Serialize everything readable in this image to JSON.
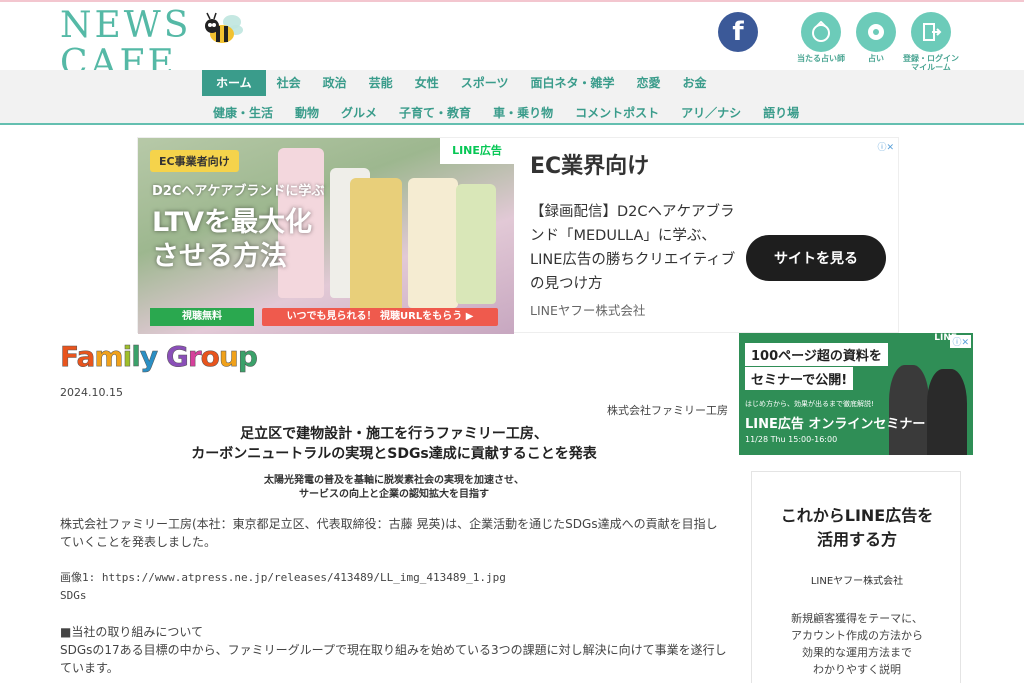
{
  "header": {
    "logo_line1": "NEWS",
    "logo_line2": "CAFE",
    "facebook_label": "f",
    "icons": [
      {
        "name": "fortune-telling",
        "label": "当たる占い師"
      },
      {
        "name": "horoscope",
        "label": "占い"
      },
      {
        "name": "register-login",
        "label": "登録・ログイン\nマイルーム"
      }
    ]
  },
  "nav": {
    "row1": [
      "ホーム",
      "社会",
      "政治",
      "芸能",
      "女性",
      "スポーツ",
      "面白ネタ・雑学",
      "恋愛",
      "お金"
    ],
    "row2": [
      "健康・生活",
      "動物",
      "グルメ",
      "子育て・教育",
      "車・乗り物",
      "コメントポスト",
      "アリ／ナシ",
      "語り場"
    ],
    "active": "ホーム"
  },
  "ad_top": {
    "badge": "EC事業者向け",
    "sub": "D2Cヘアケアブランドに学ぶ",
    "big1": "LTVを最大化",
    "big2": "させる方法",
    "green_btn": "視聴無料",
    "red_btn": "いつでも見られる！ 視聴URLをもらう ▶",
    "line_flag": "LINE広告",
    "headline": "EC業界向け",
    "body": "【録画配信】D2Cヘアケアブランド「MEDULLA」に学ぶ、LINE広告の勝ちクリエイティブの見つけ方",
    "company": "LINEヤフー株式会社",
    "cta": "サイトを見る",
    "adchoices": "ⓘ✕"
  },
  "ad_side": {
    "line1": "100ページ超の資料を",
    "line2": "セミナーで公開!",
    "small": "はじめ方から、効果が出るまで徹底解説!",
    "title": "LINE広告 オンラインセミナー",
    "date": "11/28 Thu 15:00-16:00",
    "flag": "LINE",
    "adchoices": "ⓘ✕"
  },
  "side_box": {
    "title": "これからLINE広告を活用する方",
    "company": "LINEヤフー株式会社",
    "desc": "新規顧客獲得をテーマに、アカウント作成の方法から効果的な運用方法までわかりやすく説明"
  },
  "article": {
    "logo_text": "Family Group",
    "date": "2024.10.15",
    "company": "株式会社ファミリー工房",
    "title_line1": "足立区で建物設計・施工を行うファミリー工房、",
    "title_line2": "カーボンニュートラルの実現とSDGs達成に貢献することを発表",
    "sub_line1": "太陽光発電の普及を基軸に脱炭素社会の実現を加速させ、",
    "sub_line2": "サービスの向上と企業の認知拡大を目指す",
    "para1": "株式会社ファミリー工房(本社：東京都足立区、代表取締役：古藤 晃英)は、企業活動を通じたSDGs達成への貢献を目指していくことを発表しました。",
    "image_ref": "画像1: https://www.atpress.ne.jp/releases/413489/LL_img_413489_1.jpg",
    "image_caption": "SDGs",
    "section_heading": "■当社の取り組みについて",
    "para2": "SDGsの17ある目標の中から、ファミリーグループで現在取り組みを始めている3つの課題に対し解決に向けて事業を遂行しています。"
  },
  "colors": {
    "brand_teal": "#3a9c8b",
    "logo_teal": "#55b9a6",
    "facebook_blue": "#3b5998",
    "line_green": "#06c755"
  }
}
